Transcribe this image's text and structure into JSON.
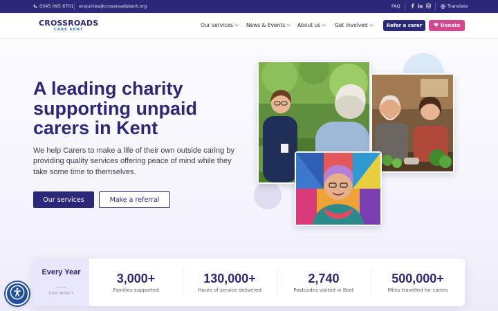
{
  "topbar": {
    "phone": "0345 095 6701",
    "email": "enquiries@crossroadskent.org",
    "faq": "FAQ",
    "translate": "Translate"
  },
  "header": {
    "logo_main": "CROSSROADS",
    "logo_sub": "CARE KENT",
    "nav": [
      {
        "label": "Our services",
        "has_dropdown": true
      },
      {
        "label": "News & Events",
        "has_dropdown": true
      },
      {
        "label": "About us",
        "has_dropdown": true
      },
      {
        "label": "Get Involved",
        "has_dropdown": true
      }
    ],
    "refer_label": "Refer a carer",
    "donate_label": "Donate"
  },
  "hero": {
    "headline": "A leading charity supporting unpaid carers in Kent",
    "subtext": "We help Carers to make a life of their own outside caring by providing quality services offering peace of mind while they take some time to themselves.",
    "primary_cta": "Our services",
    "secondary_cta": "Make a referral"
  },
  "impact": {
    "label": "Every Year",
    "sublabel": "OUR IMPACT",
    "stats": [
      {
        "value": "3,000+",
        "caption": "Families supported"
      },
      {
        "value": "130,000+",
        "caption": "Hours of service delivered"
      },
      {
        "value": "2,740",
        "caption": "Postcodes visited in Kent"
      },
      {
        "value": "500,000+",
        "caption": "Miles travelled for carers"
      }
    ]
  },
  "colors": {
    "brand_navy": "#2c2878",
    "accent_pink": "#d6468c",
    "accent_blue": "#3b7bd1",
    "accessibility_blue": "#1f4f9c"
  },
  "icons": [
    "phone-icon",
    "email-icon",
    "facebook-icon",
    "linkedin-icon",
    "instagram-icon",
    "globe-icon",
    "heart-icon",
    "accessibility-icon"
  ]
}
